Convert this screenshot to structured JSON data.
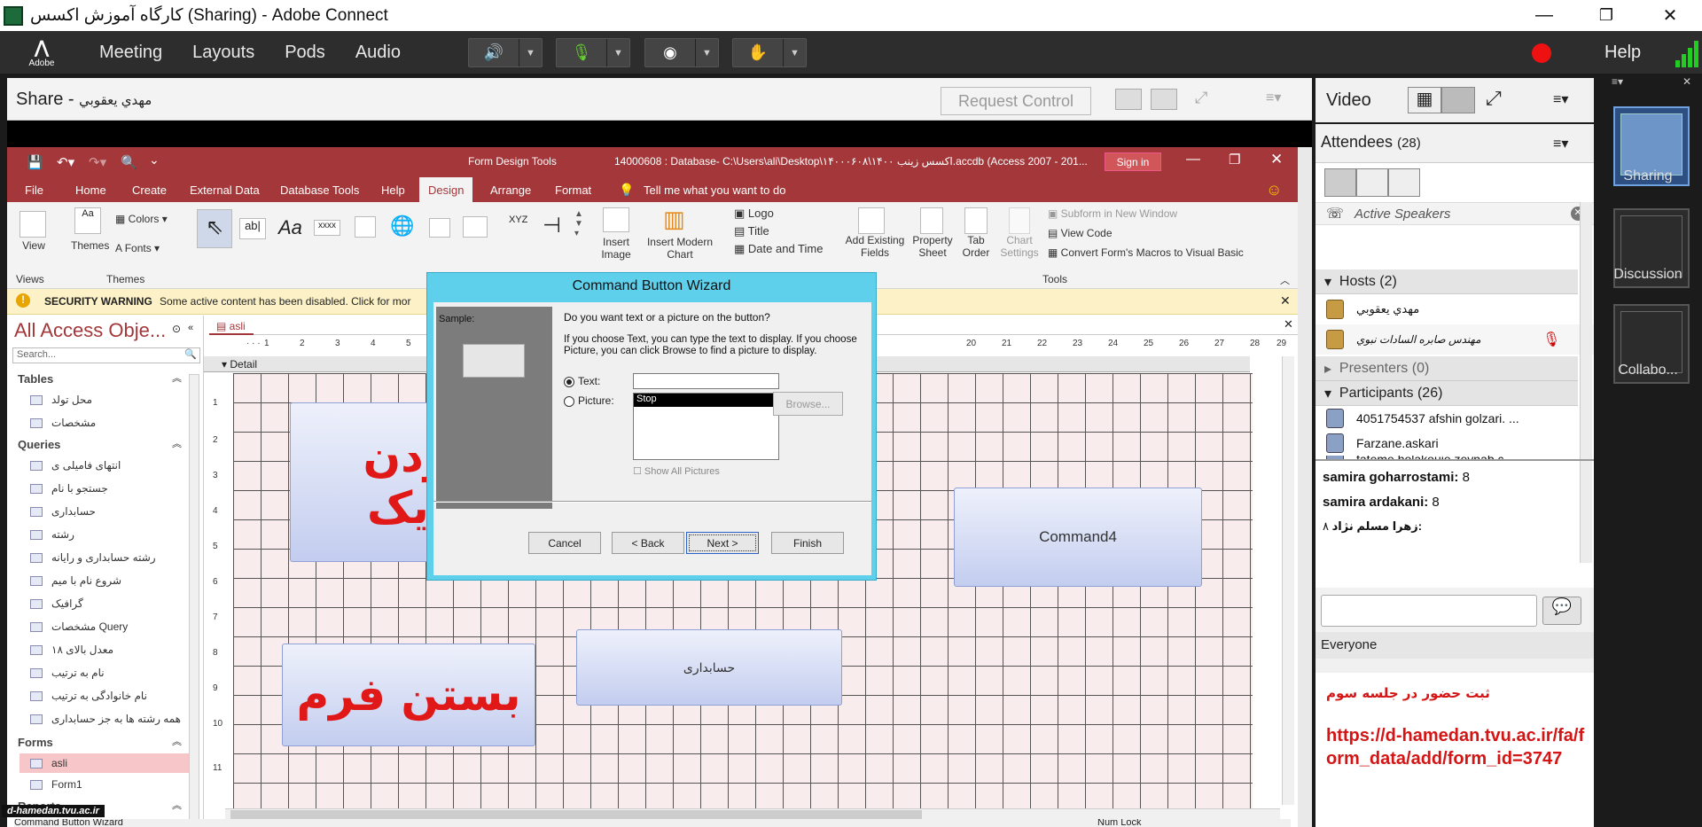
{
  "window": {
    "title": "کارگاه آموزش اکسس (Sharing) - Adobe Connect",
    "minimize": "—",
    "restore": "❐",
    "close": "✕"
  },
  "menu": {
    "logo_text": "Adobe",
    "items": [
      "Meeting",
      "Layouts",
      "Pods",
      "Audio"
    ],
    "help": "Help"
  },
  "share": {
    "title": "Share",
    "presenter": "مهدي يعقوبي",
    "request_control": "Request Control"
  },
  "access": {
    "title_center": "Form Design Tools",
    "title_path": "14000608 : Database- C:\\Users\\ali\\Desktop\\۱۴۰۰۰۶۰۸\\۱۴۰۰ اکسس زینب.accdb (Access 2007 - 201...",
    "sign_in": "Sign in",
    "tabs": [
      "File",
      "Home",
      "Create",
      "External Data",
      "Database Tools",
      "Help",
      "Design",
      "Arrange",
      "Format"
    ],
    "tell_me": "Tell me what you want to do",
    "ribbon": {
      "view": "View",
      "themes": "Themes",
      "colors": "Colors",
      "fonts": "Fonts",
      "group_views": "Views",
      "group_themes": "Themes",
      "group_tools": "Tools",
      "insert_image": "Insert Image",
      "insert_modern_chart": "Insert Modern Chart",
      "logo": "Logo",
      "title": "Title",
      "date_time": "Date and Time",
      "add_existing_fields": "Add Existing Fields",
      "property_sheet": "Property Sheet",
      "tab_order": "Tab Order",
      "chart_settings": "Chart Settings",
      "subform": "Subform in New Window",
      "view_code": "View Code",
      "convert_macros": "Convert Form's Macros to Visual Basic",
      "ctrl_text": "ab|",
      "ctrl_aa": "Aa",
      "ctrl_xxxx": "xxxx",
      "ctrl_xyz": "XYZ"
    },
    "security": {
      "label": "SECURITY WARNING",
      "text": "Some active content has been disabled. Click for mor"
    },
    "nav": {
      "title": "All Access Obje...",
      "search_placeholder": "Search...",
      "sections": [
        {
          "name": "Tables",
          "items": [
            "محل تولد",
            "مشخصات"
          ]
        },
        {
          "name": "Queries",
          "items": [
            "انتهای فامیلی ی",
            "جستجو با نام",
            "حسابداری",
            "رشته",
            "رشته حسابداری و رایانه",
            "شروع نام با میم",
            "گرافیک",
            "مشخصات Query",
            "معدل بالای ۱۸",
            "نام به ترتیب",
            "نام خانوادگی به ترتیب",
            "همه رشته ها به جز حسابداری"
          ]
        },
        {
          "name": "Forms",
          "items": [
            "asli",
            "Form1"
          ]
        },
        {
          "name": "Reports",
          "items": []
        }
      ]
    },
    "doc_tab": "asli",
    "detail": "Detail",
    "ruler_left": [
      "1",
      "2",
      "3",
      "4",
      "5"
    ],
    "ruler_right": [
      "20",
      "21",
      "22",
      "23",
      "24",
      "25",
      "26",
      "27",
      "28",
      "29"
    ],
    "vruler": [
      "1",
      "2",
      "3",
      "4",
      "5",
      "6",
      "7",
      "8",
      "9",
      "10",
      "11"
    ],
    "form_buttons": {
      "b1": "کردن",
      "b1b": "م یک",
      "b2": "Command4",
      "b3": "حسابداری",
      "b4": "بستن فرم"
    },
    "status_left": "Command Button Wizard",
    "status_right": "Num Lock"
  },
  "wizard": {
    "title": "Command Button Wizard",
    "sample": "Sample:",
    "question": "Do you want text or a picture on the button?",
    "help": "If you choose Text, you can type the text to display.  If you choose Picture, you can click Browse to find a picture to display.",
    "text_label": "Text:",
    "picture_label": "Picture:",
    "text_value": "",
    "picture_item": "Stop",
    "browse": "Browse...",
    "show_all": "Show All Pictures",
    "cancel": "Cancel",
    "back": "< Back",
    "next": "Next >",
    "finish": "Finish"
  },
  "right": {
    "video": "Video",
    "attendees": "Attendees",
    "attendees_count": "(28)",
    "active_speakers": "Active Speakers",
    "hosts": "Hosts (2)",
    "host_names": [
      "مهدي يعقوبي",
      "مهندس صابره السادات نبوي"
    ],
    "presenters": "Presenters (0)",
    "participants": "Participants (26)",
    "participant_names": [
      "4051754537 afshin golzari.  ...",
      "Farzane.askari",
      "fateme holakouie zeynab c..."
    ],
    "chat": [
      [
        "samira goharrostami:",
        "8"
      ],
      [
        "samira ardakani:",
        "8"
      ],
      [
        "زهرا مسلم نژاد:",
        "۸"
      ]
    ],
    "chat_to": "Everyone",
    "note_title": "ثبت حضور در جلسه سوم",
    "note_link": "https://d-hamedan.tvu.ac.ir/fa/form_data/add/form_id=3747"
  },
  "layouts": [
    "Sharing",
    "Discussion",
    "Collabo..."
  ],
  "watermark": "d-hamedan.tvu.ac.ir"
}
